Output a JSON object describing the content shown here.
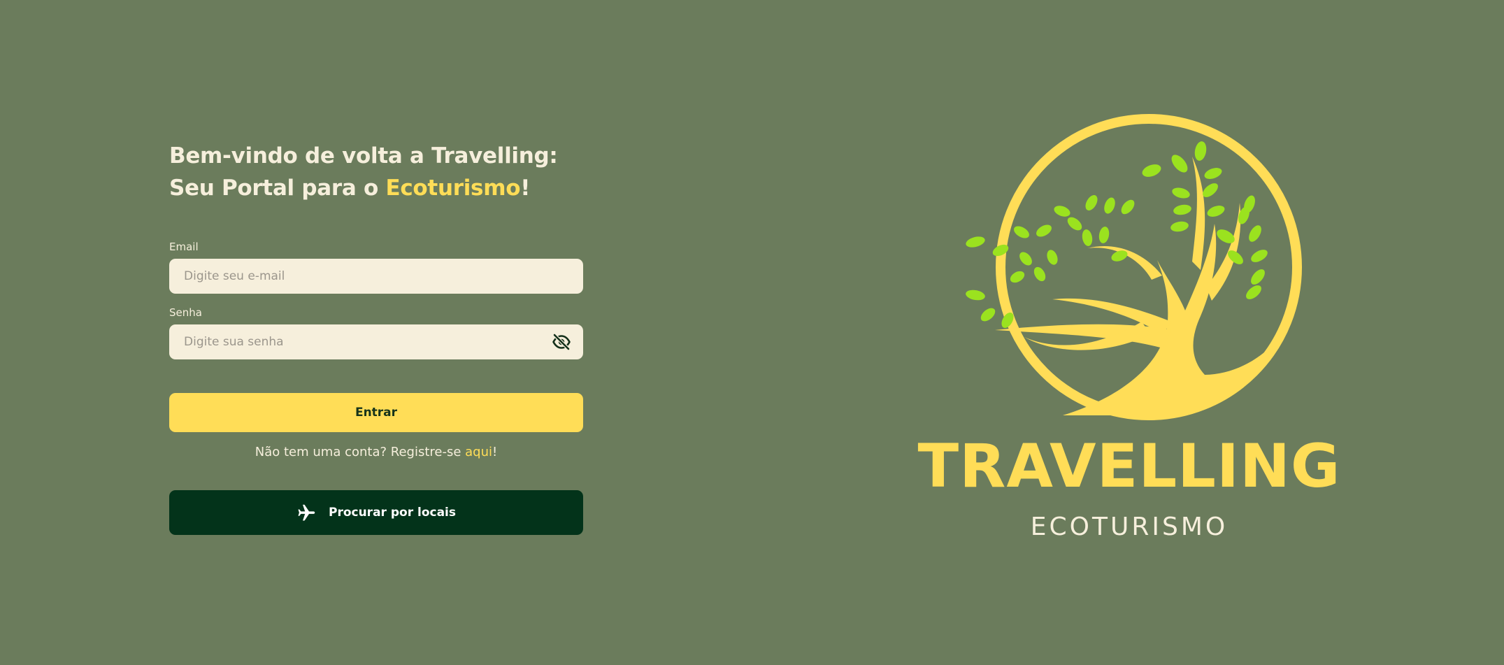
{
  "login": {
    "headline_main": "Bem-vindo de volta a Travelling: Seu Portal para o ",
    "headline_accent": "Ecoturismo",
    "headline_end": "!",
    "email": {
      "label": "Email",
      "placeholder": "Digite seu e-mail",
      "value": ""
    },
    "password": {
      "label": "Senha",
      "placeholder": "Digite sua senha",
      "value": "",
      "toggle_icon": "eye-slash-icon"
    },
    "submit_label": "Entrar",
    "register_prefix": "Não tem uma conta? Registre-se ",
    "register_link": "aqui",
    "register_suffix": "!",
    "search_label": "Procurar por locais",
    "search_icon": "airplane-icon"
  },
  "branding": {
    "logo_icon": "tree-circle-logo-icon",
    "name": "TRAVELLING",
    "tagline": "ECOTURISMO"
  },
  "colors": {
    "background": "#6b7c5c",
    "cream": "#f6efdc",
    "accent_yellow": "#ffdd57",
    "dark_green": "#03331a",
    "leaf_green": "#9be21f"
  }
}
